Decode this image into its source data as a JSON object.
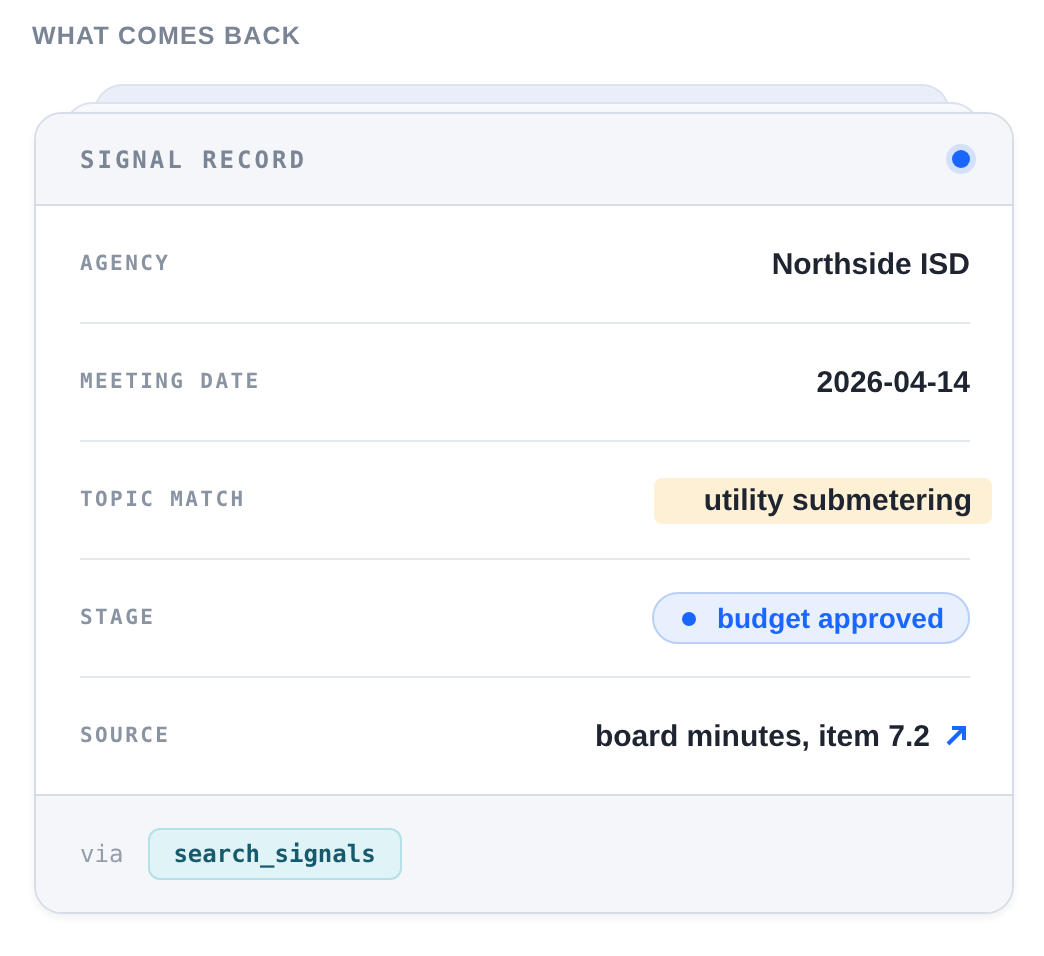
{
  "section_title": "WHAT COMES BACK",
  "card": {
    "title": "SIGNAL RECORD",
    "rows": [
      {
        "label": "AGENCY",
        "value": "Northside ISD",
        "kind": "text"
      },
      {
        "label": "MEETING DATE",
        "value": "2026-04-14",
        "kind": "text"
      },
      {
        "label": "TOPIC MATCH",
        "value": "utility submetering",
        "kind": "highlight"
      },
      {
        "label": "STAGE",
        "value": "budget approved",
        "kind": "pill"
      },
      {
        "label": "SOURCE",
        "value": "board minutes, item 7.2",
        "kind": "link"
      }
    ],
    "footer": {
      "prefix": "via",
      "tool": "search_signals"
    }
  }
}
